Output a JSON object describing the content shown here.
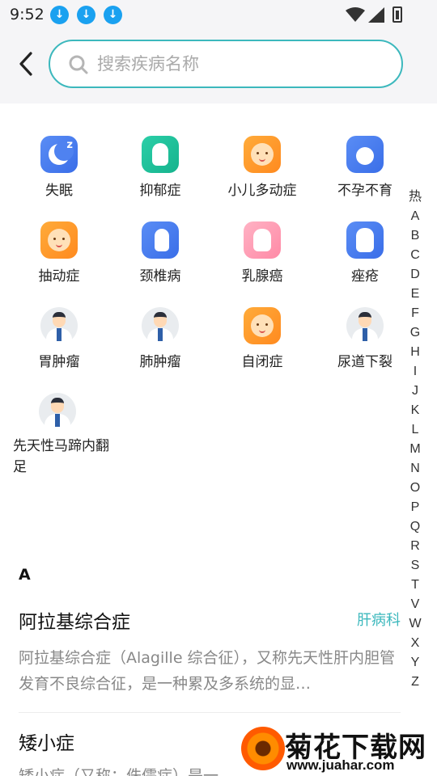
{
  "status_bar": {
    "time": "9:52",
    "download_icon_count": 3
  },
  "search": {
    "placeholder": "搜索疾病名称",
    "value": ""
  },
  "hot_diseases": [
    {
      "label": "失眠",
      "icon": "sleep-moon-icon",
      "color": "#4f82f0"
    },
    {
      "label": "抑郁症",
      "icon": "depression-figure-icon",
      "color": "#1fc09a"
    },
    {
      "label": "小儿多动症",
      "icon": "baby-face-icon",
      "color": "#ff9a2a"
    },
    {
      "label": "不孕不育",
      "icon": "pregnancy-icon",
      "color": "#4f82f0"
    },
    {
      "label": "抽动症",
      "icon": "baby-face-icon",
      "color": "#ff9a2a"
    },
    {
      "label": "颈椎病",
      "icon": "neck-icon",
      "color": "#4f82f0"
    },
    {
      "label": "乳腺癌",
      "icon": "breast-icon",
      "color": "#ff9db4"
    },
    {
      "label": "痤疮",
      "icon": "hand-icon",
      "color": "#4f82f0"
    },
    {
      "label": "胃肿瘤",
      "icon": "doctor-avatar-icon",
      "color": "#e9ecef"
    },
    {
      "label": "肺肿瘤",
      "icon": "doctor-avatar-icon",
      "color": "#e9ecef"
    },
    {
      "label": "自闭症",
      "icon": "baby-face-icon",
      "color": "#ff9a2a"
    },
    {
      "label": "尿道下裂",
      "icon": "doctor-avatar-icon",
      "color": "#e9ecef"
    },
    {
      "label": "先天性马蹄内翻足",
      "icon": "doctor-avatar-icon",
      "color": "#e9ecef"
    }
  ],
  "index_letters": [
    "热",
    "A",
    "B",
    "C",
    "D",
    "E",
    "F",
    "G",
    "H",
    "I",
    "J",
    "K",
    "L",
    "M",
    "N",
    "O",
    "P",
    "Q",
    "R",
    "S",
    "T",
    "V",
    "W",
    "X",
    "Y",
    "Z"
  ],
  "section": {
    "letter": "A"
  },
  "diseases": [
    {
      "name": "阿拉基综合症",
      "department": "肝病科",
      "description": "阿拉基综合症（Alagille 综合征），又称先天性肝内胆管发育不良综合征，是一种累及多系统的显…"
    },
    {
      "name": "矮小症",
      "department": "",
      "description": "矮小症（又称：侏儒症）是一"
    }
  ],
  "watermark": {
    "title": "菊花下载网",
    "url": "www.juahar.com"
  }
}
